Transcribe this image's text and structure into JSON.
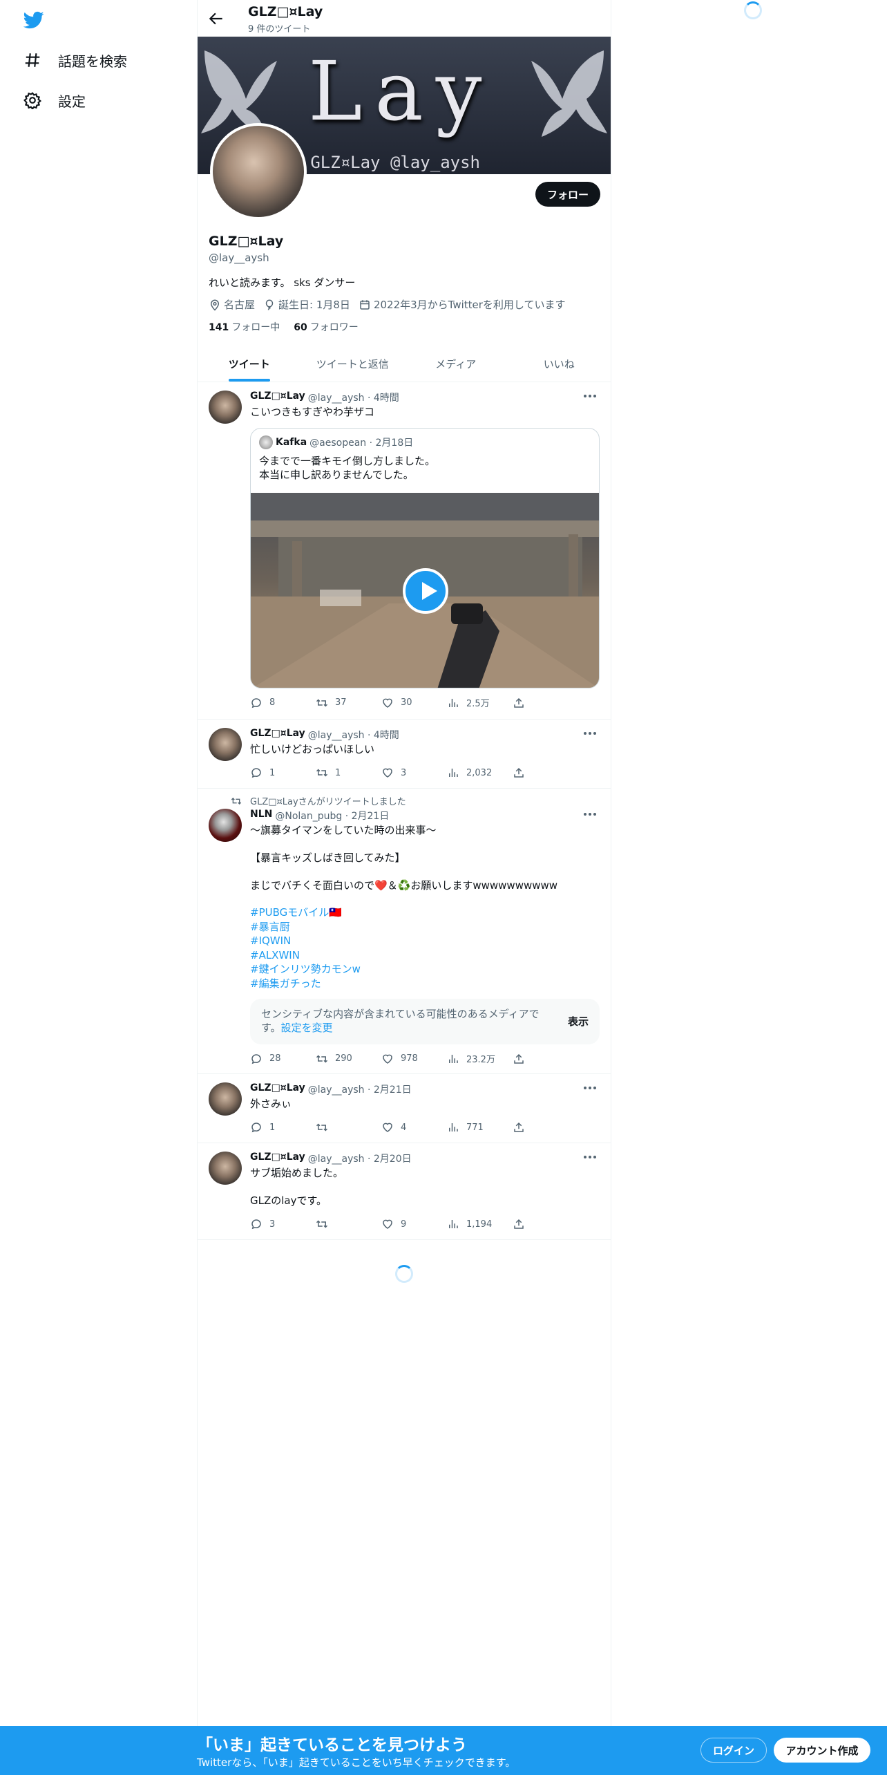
{
  "nav": {
    "explore": "話題を検索",
    "settings": "設定"
  },
  "header": {
    "name": "GLZ□¤Lay",
    "tweet_count": "9 件のツイート"
  },
  "banner": {
    "title": "Lay",
    "subtitle": "S: GLZ¤Lay    @lay_aysh"
  },
  "profile": {
    "follow_label": "フォロー",
    "name": "GLZ□¤Lay",
    "handle": "@lay__aysh",
    "bio": "れいと読みます。 sks ダンサー",
    "location": "名古屋",
    "birthday": "誕生日: 1月8日",
    "joined": "2022年3月からTwitterを利用しています",
    "following_count": "141",
    "following_label": "フォロー中",
    "followers_count": "60",
    "followers_label": "フォロワー"
  },
  "tabs": [
    "ツイート",
    "ツイートと返信",
    "メディア",
    "いいね"
  ],
  "tweets": [
    {
      "name": "GLZ□¤Lay",
      "meta": "@lay__aysh · 4時間",
      "text": "こいつきもすぎやわ芋ザコ",
      "quote": {
        "name": "Kafka",
        "meta": "@aesopean · 2月18日",
        "text": "今までで一番キモイ倒し方しました。\n本当に申し訳ありませんでした。"
      },
      "replies": "8",
      "retweets": "37",
      "likes": "30",
      "views": "2.5万"
    },
    {
      "name": "GLZ□¤Lay",
      "meta": "@lay__aysh · 4時間",
      "text": "忙しいけどおっぱいほしい",
      "replies": "1",
      "retweets": "1",
      "likes": "3",
      "views": "2,032"
    },
    {
      "retweet_label": "GLZ□¤Layさんがリツイートしました",
      "name": "NLN",
      "meta": "@Nolan_pubg · 2月21日",
      "text": "〜旗募タイマンをしていた時の出来事〜\n\n【暴言キッズしばき回してみた】\n\nまじでバチくそ面白いので❤️＆♻️お願いしますwwwwwwwwww",
      "hashtags": [
        "#PUBGモバイル🇹🇼",
        "#暴言厨",
        "#IQWIN",
        "#ALXWIN",
        "#鍵インリツ勢カモンw",
        "#編集ガチった"
      ],
      "sensitive_text": "センシティブな内容が含まれている可能性のあるメディアです。",
      "sensitive_link": "設定を変更",
      "sensitive_show": "表示",
      "replies": "28",
      "retweets": "290",
      "likes": "978",
      "views": "23.2万"
    },
    {
      "name": "GLZ□¤Lay",
      "meta": "@lay__aysh · 2月21日",
      "text": "外さみぃ",
      "replies": "1",
      "retweets": "",
      "likes": "4",
      "views": "771"
    },
    {
      "name": "GLZ□¤Lay",
      "meta": "@lay__aysh · 2月20日",
      "text": "サブ垢始めました。\n\nGLZのlayです。",
      "replies": "3",
      "retweets": "",
      "likes": "9",
      "views": "1,194"
    }
  ],
  "bottom_bar": {
    "title": "「いま」起きていることを見つけよう",
    "subtitle": "Twitterなら、「いま」起きていることをいち早くチェックできます。",
    "login": "ログイン",
    "signup": "アカウント作成"
  },
  "colors": {
    "accent": "#1d9bf0",
    "text": "#0f1419",
    "secondary": "#536471"
  }
}
